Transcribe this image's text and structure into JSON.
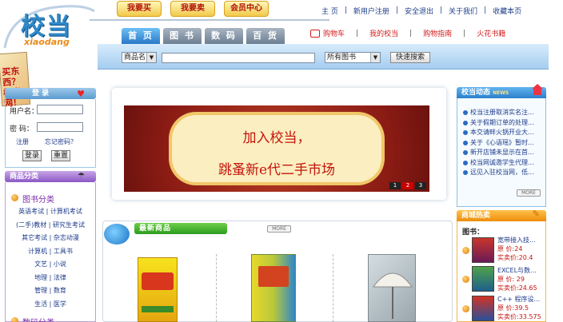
{
  "logo": {
    "text": "校当",
    "pinyin": "xiaodang"
  },
  "top_buttons": [
    "我要买",
    "我要卖",
    "会员中心"
  ],
  "top_links": [
    "主 页",
    "新用户注册",
    "安全退出",
    "关于我们",
    "收藏本页"
  ],
  "tabs": [
    "首 页",
    "图 书",
    "数 码",
    "百 货"
  ],
  "red_links": [
    "购物车",
    "我的校当",
    "购物指南",
    "火花书籍"
  ],
  "search": {
    "field_select": "商品名",
    "category_select": "所有图书",
    "button": "快速搜索"
  },
  "ad": {
    "text": "买东西？校当网！"
  },
  "login": {
    "title": "登 录",
    "username_label": "用户名：",
    "password_label": "密  码：",
    "register": "注册",
    "forgot": "忘记密码？",
    "login_button": "登录",
    "reset_button": "重置"
  },
  "categories": {
    "title": "商品分类",
    "group1_title": "图书分类",
    "rows": [
      "英语考试 | 计算机考试",
      "(二手)教材 | 研究生考试",
      "其它考试 | 杂志动漫",
      "计算机 | 工具书",
      "文艺 | 小说",
      "地理 | 法律",
      "管理 | 数育",
      "生活 | 医学"
    ],
    "group2_title": "数码分类"
  },
  "banner": {
    "line1": "加入校当，",
    "line2": "跳蚤新e代二手市场",
    "pages": [
      "1",
      "2",
      "3"
    ],
    "active_page": "2"
  },
  "new_products": {
    "title": "最新商品",
    "more": "MORE"
  },
  "news": {
    "title": "校当动态",
    "title_en": "NEWS",
    "more": "MORE",
    "items": [
      "校当注册取消实名注...",
      "关于假期订单的处理...",
      "本交请畔火锅开业大...",
      "关于《心语瑶》暂时...",
      "新开店铺未显示在首...",
      "校当网诚邀学生代理...",
      "远见入驻校当网，低..."
    ]
  },
  "hot": {
    "title": "商城热卖",
    "subtitle": "图书：",
    "items": [
      {
        "name": "宽带接入技...",
        "orig": "原  价:24",
        "price": "实卖价:20.4"
      },
      {
        "name": "EXCEL与数...",
        "orig": "原  价: 29",
        "price": "实卖价:24.65"
      },
      {
        "name": "C++ 程序设...",
        "orig": "原  价:39.5",
        "price": "实卖价:33.575"
      }
    ]
  },
  "colors": {
    "accent_blue": "#2b78c8",
    "brand_red": "#c4140c",
    "orange": "#ee8c0c"
  }
}
